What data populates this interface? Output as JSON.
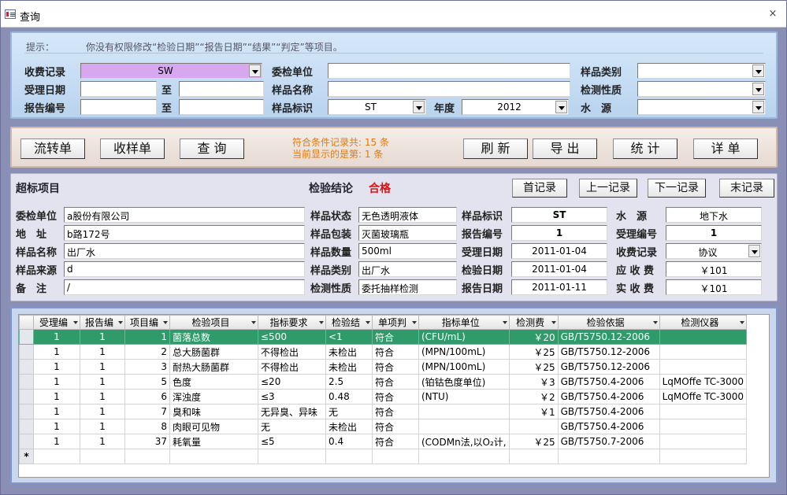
{
  "window": {
    "title": "查询",
    "close_glyph": "×"
  },
  "hint": {
    "label": "提示：",
    "text": "你没有权限修改“检验日期”“报告日期”“结果”“判定”等项目。"
  },
  "filters": {
    "fee_label": "收费记录",
    "fee_value": "SW",
    "client_label": "委检单位",
    "client_value": "",
    "sample_type_label": "样品类别",
    "sample_type_value": "",
    "accept_date_label": "受理日期",
    "accept_from": "",
    "to_label": "至",
    "accept_to": "",
    "sample_name_label": "样品名称",
    "sample_name_value": "",
    "test_nature_label": "检测性质",
    "test_nature_value": "",
    "report_no_label": "报告编号",
    "report_from": "",
    "report_to_label": "至",
    "report_to": "",
    "sample_mark_label": "样品标识",
    "sample_mark_value": "ST",
    "year_label": "年度",
    "year_value": "2012",
    "water_label": "水　源",
    "water_value": ""
  },
  "toolbar": {
    "flow_label": "流转单",
    "receive_label": "收样单",
    "query_label": "查 询",
    "count_line1": "符合条件记录共:  15 条",
    "count_line2": "当前显示的是第:  1 条",
    "refresh_label": "刷 新",
    "export_label": "导 出",
    "stats_label": "统 计",
    "detail_label": "详 单"
  },
  "record": {
    "over_label": "超标项目",
    "conclusion_label": "检验结论",
    "conclusion_value": "合格",
    "first_label": "首记录",
    "prev_label": "上一记录",
    "next_label": "下一记录",
    "last_label": "末记录",
    "client_label": "委检单位",
    "client_value": "a股份有限公司",
    "address_label": "地　址",
    "address_value": "b路172号",
    "name_label": "样品名称",
    "name_value": "出厂水",
    "source_label": "样品来源",
    "source_value": "d",
    "remark_label": "备　注",
    "remark_value": "/",
    "state_label": "样品状态",
    "state_value": "无色透明液体",
    "package_label": "样品包装",
    "package_value": "灭菌玻璃瓶",
    "qty_label": "样品数量",
    "qty_value": "500ml",
    "type_label": "样品类别",
    "type_value": "出厂水",
    "nature_label": "检测性质",
    "nature_value": "委托抽样检测",
    "mark_label": "样品标识",
    "mark_value": "ST",
    "report_no_label": "报告编号",
    "report_no_value": "1",
    "accept_date_label": "受理日期",
    "accept_date_value": "2011-01-04",
    "test_date_label": "检验日期",
    "test_date_value": "2011-01-04",
    "report_date_label": "报告日期",
    "report_date_value": "2011-01-11",
    "water_label": "水　源",
    "water_value": "地下水",
    "accept_no_label": "受理编号",
    "accept_no_value": "1",
    "fee_record_label": "收费记录",
    "fee_record_value": "协议",
    "due_label": "应 收 费",
    "due_value": "￥101",
    "paid_label": "实 收 费",
    "paid_value": "￥101"
  },
  "table": {
    "headers": [
      "受理编",
      "报告编",
      "项目编",
      "检验项目",
      "指标要求",
      "检验结",
      "单项判",
      "指标单位",
      "检测费",
      "检验依据",
      "检测仪器"
    ],
    "rows": [
      [
        "1",
        "1",
        "1",
        "菌落总数",
        "≤500",
        "<1",
        "符合",
        "(CFU/mL)",
        "￥20",
        "GB/T5750.12-2006",
        ""
      ],
      [
        "1",
        "1",
        "2",
        "总大肠菌群",
        "不得检出",
        "未检出",
        "符合",
        "(MPN/100mL)",
        "￥25",
        "GB/T5750.12-2006",
        ""
      ],
      [
        "1",
        "1",
        "3",
        "耐热大肠菌群",
        "不得检出",
        "未检出",
        "符合",
        "(MPN/100mL)",
        "￥25",
        "GB/T5750.12-2006",
        ""
      ],
      [
        "1",
        "1",
        "5",
        "色度",
        "≤20",
        "2.5",
        "符合",
        "(铂钴色度单位)",
        "￥3",
        "GB/T5750.4-2006",
        "LqMOffe TC-3000"
      ],
      [
        "1",
        "1",
        "6",
        "浑浊度",
        "≤3",
        "0.48",
        "符合",
        "(NTU)",
        "￥2",
        "GB/T5750.4-2006",
        "LqMOffe TC-3000"
      ],
      [
        "1",
        "1",
        "7",
        "臭和味",
        "无异臭、异味",
        "无",
        "符合",
        "",
        "￥1",
        "GB/T5750.4-2006",
        ""
      ],
      [
        "1",
        "1",
        "8",
        "肉眼可见物",
        "无",
        "未检出",
        "符合",
        "",
        "",
        "GB/T5750.4-2006",
        ""
      ],
      [
        "1",
        "1",
        "37",
        "耗氧量",
        "≤5",
        "0.4",
        "符合",
        "(CODMn法,以O₂计,",
        "￥25",
        "GB/T5750.7-2006",
        ""
      ]
    ],
    "new_row_marker": "*"
  },
  "colors": {
    "highlight_row": "#2f9a6a",
    "fee_field": "#d7a8f0",
    "conclusion": "#dd1111",
    "count_text": "#e07a10"
  }
}
